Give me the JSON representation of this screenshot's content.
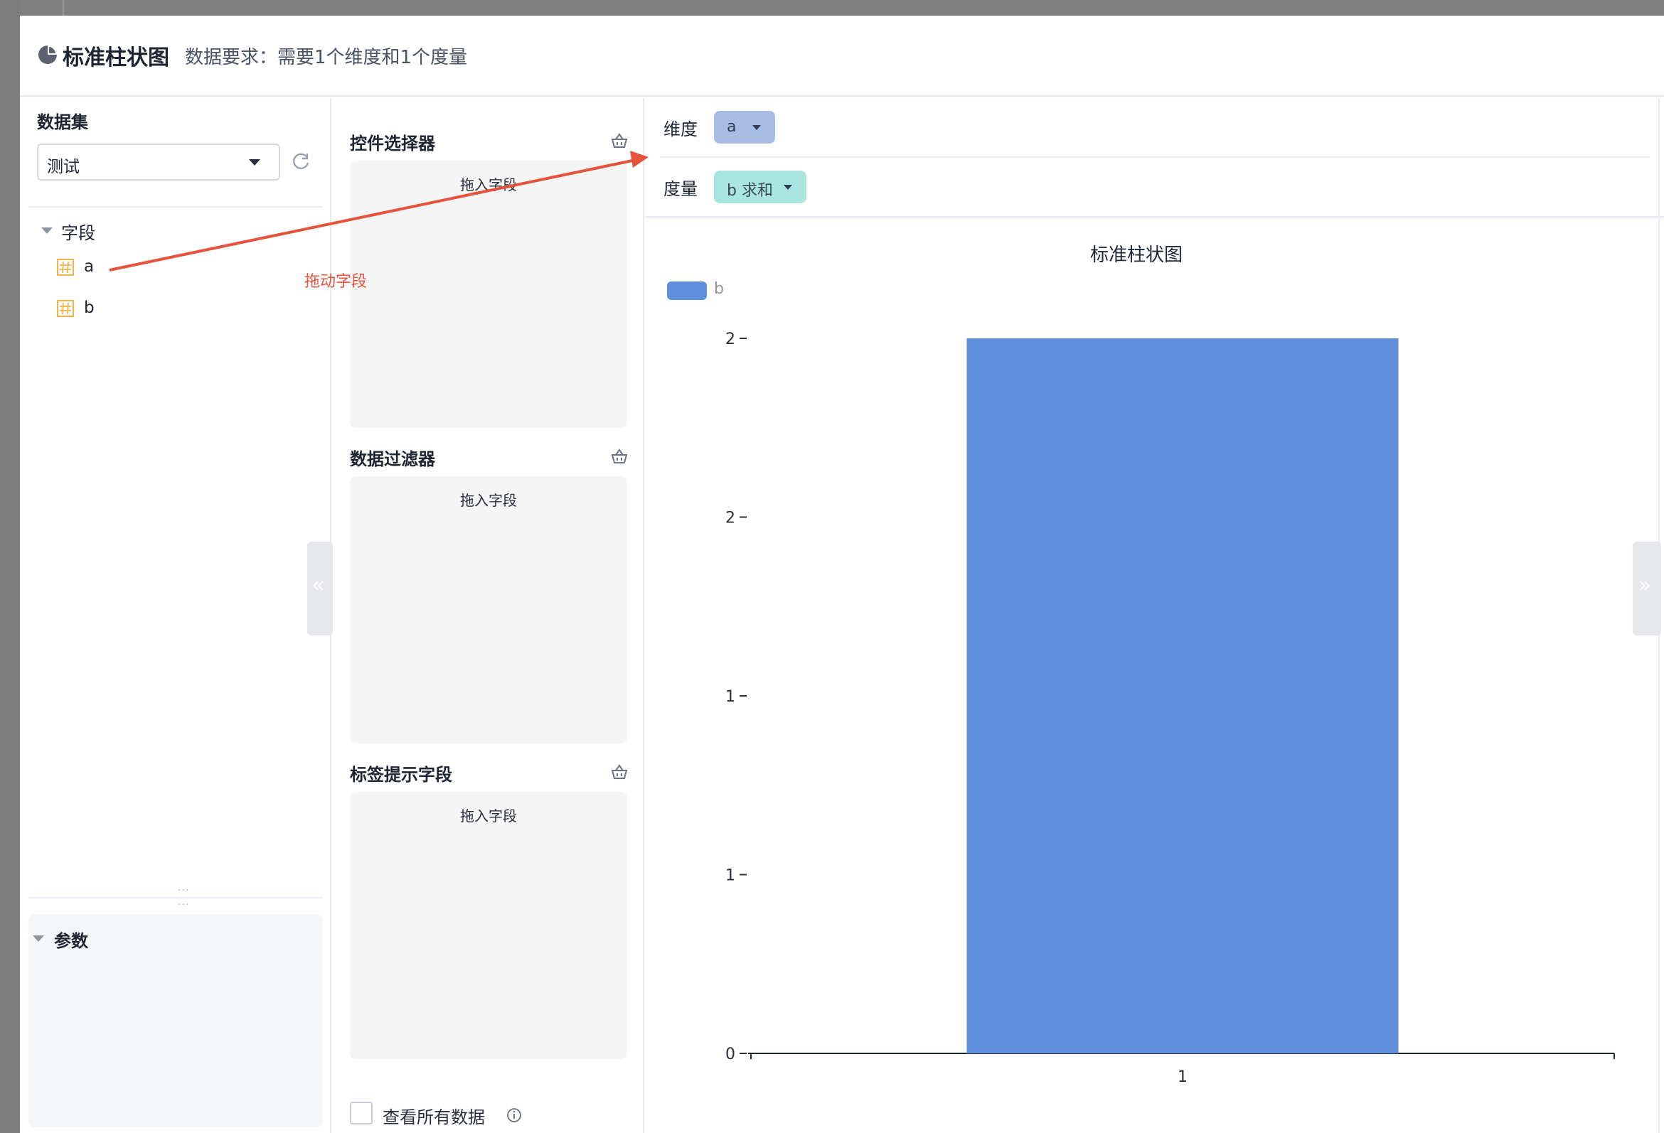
{
  "dialog": {
    "title": "标准柱状图",
    "subtitle": "数据要求：需要1个维度和1个度量"
  },
  "left": {
    "dataset_title": "数据集",
    "dataset_value": "测试",
    "fields_title": "字段",
    "fields": [
      "a",
      "b"
    ],
    "params_title": "参数"
  },
  "middle": {
    "sections": [
      {
        "title": "控件选择器",
        "hint": "拖入字段"
      },
      {
        "title": "数据过滤器",
        "hint": "拖入字段"
      },
      {
        "title": "标签提示字段",
        "hint": "拖入字段"
      }
    ],
    "view_all_label": "查看所有数据"
  },
  "shelves": {
    "dimension_label": "维度",
    "dimension_value": "a",
    "measure_label": "度量",
    "measure_value": "b 求和"
  },
  "annotation": "拖动字段",
  "colors": {
    "bar": "#5f8fdb",
    "dimension_pill": "#a8bde3",
    "measure_pill": "#a9e6df",
    "annotation": "#e6533c"
  },
  "chart_data": {
    "type": "bar",
    "title": "标准柱状图",
    "categories": [
      "1"
    ],
    "series": [
      {
        "name": "b",
        "values": [
          2
        ]
      }
    ],
    "ylim": [
      0,
      2
    ],
    "y_tick_labels": [
      "0",
      "1",
      "1",
      "2",
      "2"
    ],
    "y_tick_values": [
      0,
      0.5,
      1,
      1.5,
      2
    ],
    "legend": "top-left",
    "grid": false
  }
}
